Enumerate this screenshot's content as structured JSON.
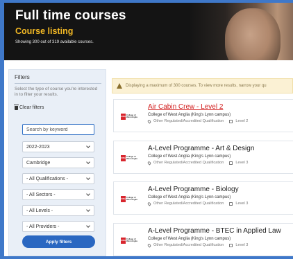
{
  "hero": {
    "title": "Full time courses",
    "subtitle": "Course listing",
    "count_text": "Showing 300 out of 319 available courses."
  },
  "filters": {
    "title": "Filters",
    "help": "Select the type of course you're interested in to filter your results.",
    "clear_label": "Clear filters",
    "search_placeholder": "Search by keyword",
    "selects": [
      {
        "value": "2022-2023"
      },
      {
        "value": "Cambridge"
      },
      {
        "value": "- All Qualifications -"
      },
      {
        "value": "- All Sectors -"
      },
      {
        "value": "- All Levels -"
      },
      {
        "value": "- All Providers -"
      }
    ],
    "apply_label": "Apply filters"
  },
  "notice": {
    "text": "Displaying a maximum of 300 courses. To view more results, narrow your qu"
  },
  "courses": [
    {
      "name": "Air Cabin Crew - Level 2",
      "college": "College of West Anglia (King's Lynn campus)",
      "qualification": "Other Regulated/Accredited Qualification",
      "level": "Level 2"
    },
    {
      "name": "A-Level Programme - Art & Design",
      "college": "College of West Anglia (King's Lynn campus)",
      "qualification": "Other Regulated/Accredited Qualification",
      "level": "Level 3"
    },
    {
      "name": "A-Level Programme - Biology",
      "college": "College of West Anglia (King's Lynn campus)",
      "qualification": "Other Regulated/Accredited Qualification",
      "level": "Level 3"
    },
    {
      "name": "A-Level Programme - BTEC in Applied Law",
      "college": "College of West Anglia (King's Lynn campus)",
      "qualification": "Other Regulated/Accredited Qualification",
      "level": "Level 3"
    }
  ],
  "logo": {
    "mark": "CWA",
    "text": "College of West Anglia"
  }
}
